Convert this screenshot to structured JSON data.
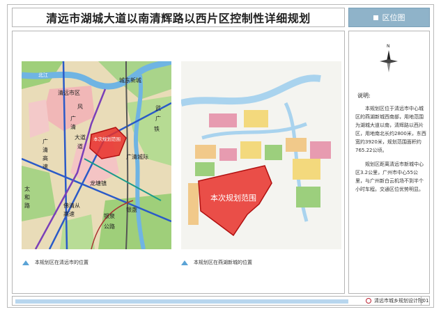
{
  "header": {
    "title": "清远市湖城大道以南清辉路以西片区控制性详细规划",
    "location_tab": "区位图"
  },
  "map1": {
    "labels": {
      "beijiang": "北江",
      "qingyuan_west": "清远市区",
      "feng": "风",
      "guangqing": "广",
      "guangqing2": "清",
      "dadao": "大道",
      "da2": "道",
      "wu": "武",
      "guang_gao": "广",
      "qing_gao": "清",
      "gao": "高",
      "su": "速",
      "taihe": "太",
      "he": "和",
      "lu": "路",
      "plan_area": "本次规划范围",
      "longtang": "龙塘镇",
      "yinzhan": "银盏",
      "yinquan": "银泉",
      "gonglu": "公路",
      "foqingcong": "佛清从",
      "gaosu": "高速",
      "tie": "铁",
      "guangqing_cj": "广清城际",
      "east_city": "城东新城"
    },
    "caption": "本规划区在清远市的位置",
    "colors": {
      "plan_fill": "#e8302a",
      "plan_stroke": "#b01010"
    }
  },
  "map2": {
    "plan_label": "本次规划范围",
    "caption": "本规划区在燕湖新城的位置"
  },
  "side": {
    "compass_n": "N",
    "desc_title": "说明:",
    "paragraphs": [
      "本规划区位于清远市中心城区的燕湖新城西南部，用地范围为湖城大道以南，清辉路以西片区，用地南北长约2800米，东西宽约3920米，规划范围面积约765.22公顷。",
      "规划区距离清远市新城中心区3.2公里，广州市中心55公里，与广州新白云机场不到半个小时车程。交通区位优势明显。"
    ]
  },
  "footer": {
    "org": "清远市城乡规划设计院",
    "page": "01"
  }
}
